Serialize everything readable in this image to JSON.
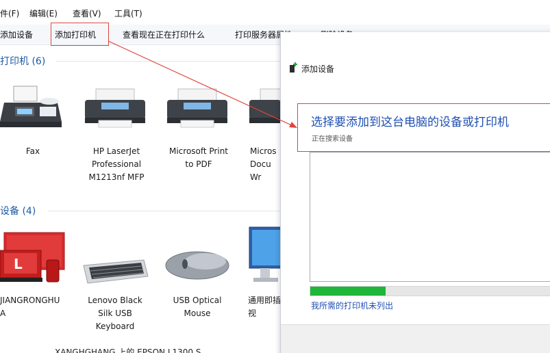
{
  "menu": {
    "items": [
      "件(F)",
      "编辑(E)",
      "查看(V)",
      "工具(T)"
    ]
  },
  "toolbar": {
    "add_device": "添加设备",
    "add_printer": "添加打印机",
    "see_printing": "查看现在正在打印什么",
    "print_server_props": "打印服务器属性",
    "remove_device": "删除设备"
  },
  "printers_section": {
    "title": "打印机 (6)",
    "items": [
      {
        "label": "Fax",
        "icon": "fax-icon"
      },
      {
        "label": "HP LaserJet\nProfessional\nM1213nf MFP",
        "icon": "printer-icon"
      },
      {
        "label": "Microsoft Print\nto PDF",
        "icon": "printer-icon"
      },
      {
        "label": "Micros\nDocu\nWr",
        "icon": "printer-icon"
      }
    ]
  },
  "devices_section": {
    "title": "设备 (4)",
    "items": [
      {
        "label": "JIANGRONGHU\nA",
        "icon": "computer-icon"
      },
      {
        "label": "Lenovo Black\nSilk USB\nKeyboard",
        "icon": "keyboard-icon"
      },
      {
        "label": "USB Optical\nMouse",
        "icon": "mouse-icon"
      },
      {
        "label": "通用即插\n视",
        "icon": "monitor-icon"
      }
    ]
  },
  "dialog": {
    "title": "添加设备",
    "heading": "选择要添加到这台电脑的设备或打印机",
    "subtitle": "正在搜索设备",
    "progress_percent": 30,
    "link": "我所需的打印机未列出"
  },
  "bottom_text": "XANGHGHANG 上的 EPSON L1300 S",
  "colors": {
    "accent_blue": "#1f4fb3",
    "section_blue": "#1c5ba6",
    "annotation_red": "#e0443a",
    "progress_green": "#1fb63a"
  }
}
